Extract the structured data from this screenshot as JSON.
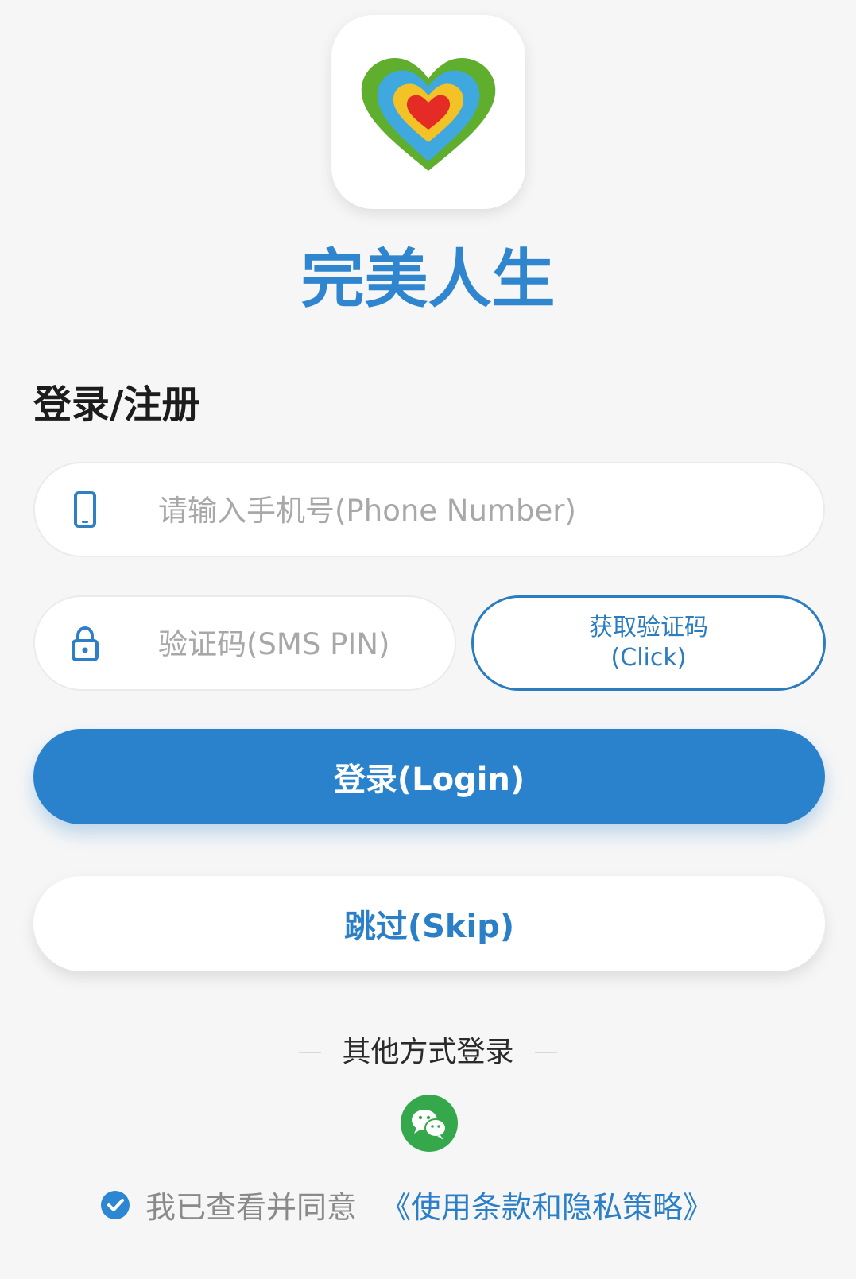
{
  "app": {
    "name": "完美人生",
    "logo_icon": "heart-logo-icon"
  },
  "form": {
    "title": "登录/注册",
    "phone": {
      "icon": "phone-icon",
      "placeholder": "请输入手机号(Phone Number)",
      "value": ""
    },
    "pin": {
      "icon": "lock-icon",
      "placeholder": "验证码(SMS PIN)",
      "value": ""
    },
    "sms_button": {
      "line1": "获取验证码",
      "line2": "(Click)"
    },
    "login_button": "登录(Login)",
    "skip_button": "跳过(Skip)"
  },
  "other_login": {
    "label": "其他方式登录",
    "wechat_icon": "wechat-icon"
  },
  "agreement": {
    "checked": true,
    "text": "我已查看并同意",
    "link": "《使用条款和隐私策略》"
  },
  "colors": {
    "primary": "#2a82cd",
    "background": "#f6f6f6",
    "wechat": "#35a84b"
  }
}
